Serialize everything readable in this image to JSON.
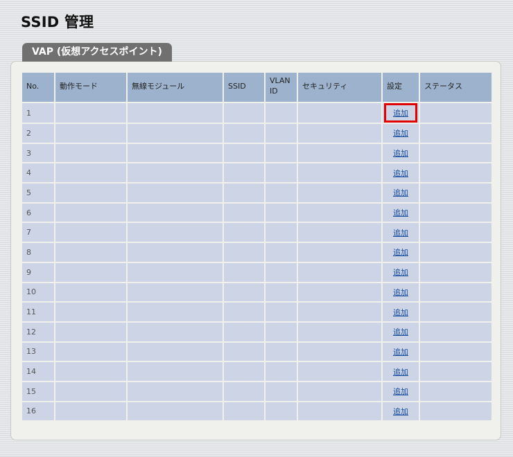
{
  "page": {
    "title": "SSID 管理"
  },
  "tab": {
    "label": "VAP (仮想アクセスポイント)"
  },
  "table": {
    "headers": {
      "no": "No.",
      "mode": "動作モード",
      "module": "無線モジュール",
      "ssid": "SSID",
      "vlan_line1": "VLAN",
      "vlan_line2": "ID",
      "security": "セキュリティ",
      "setting": "設定",
      "status": "ステータス"
    },
    "rows": [
      {
        "no": "1",
        "mode": "",
        "module": "",
        "ssid": "",
        "vlan": "",
        "security": "",
        "action": "追加",
        "status": "",
        "highlighted": true
      },
      {
        "no": "2",
        "mode": "",
        "module": "",
        "ssid": "",
        "vlan": "",
        "security": "",
        "action": "追加",
        "status": ""
      },
      {
        "no": "3",
        "mode": "",
        "module": "",
        "ssid": "",
        "vlan": "",
        "security": "",
        "action": "追加",
        "status": ""
      },
      {
        "no": "4",
        "mode": "",
        "module": "",
        "ssid": "",
        "vlan": "",
        "security": "",
        "action": "追加",
        "status": ""
      },
      {
        "no": "5",
        "mode": "",
        "module": "",
        "ssid": "",
        "vlan": "",
        "security": "",
        "action": "追加",
        "status": ""
      },
      {
        "no": "6",
        "mode": "",
        "module": "",
        "ssid": "",
        "vlan": "",
        "security": "",
        "action": "追加",
        "status": ""
      },
      {
        "no": "7",
        "mode": "",
        "module": "",
        "ssid": "",
        "vlan": "",
        "security": "",
        "action": "追加",
        "status": ""
      },
      {
        "no": "8",
        "mode": "",
        "module": "",
        "ssid": "",
        "vlan": "",
        "security": "",
        "action": "追加",
        "status": ""
      },
      {
        "no": "9",
        "mode": "",
        "module": "",
        "ssid": "",
        "vlan": "",
        "security": "",
        "action": "追加",
        "status": ""
      },
      {
        "no": "10",
        "mode": "",
        "module": "",
        "ssid": "",
        "vlan": "",
        "security": "",
        "action": "追加",
        "status": ""
      },
      {
        "no": "11",
        "mode": "",
        "module": "",
        "ssid": "",
        "vlan": "",
        "security": "",
        "action": "追加",
        "status": ""
      },
      {
        "no": "12",
        "mode": "",
        "module": "",
        "ssid": "",
        "vlan": "",
        "security": "",
        "action": "追加",
        "status": ""
      },
      {
        "no": "13",
        "mode": "",
        "module": "",
        "ssid": "",
        "vlan": "",
        "security": "",
        "action": "追加",
        "status": ""
      },
      {
        "no": "14",
        "mode": "",
        "module": "",
        "ssid": "",
        "vlan": "",
        "security": "",
        "action": "追加",
        "status": ""
      },
      {
        "no": "15",
        "mode": "",
        "module": "",
        "ssid": "",
        "vlan": "",
        "security": "",
        "action": "追加",
        "status": ""
      },
      {
        "no": "16",
        "mode": "",
        "module": "",
        "ssid": "",
        "vlan": "",
        "security": "",
        "action": "追加",
        "status": ""
      }
    ]
  },
  "colors": {
    "header_bg": "#9db3cd",
    "row_bg": "#ccd4e6",
    "tab_bg": "#707070",
    "link": "#1a4fa0",
    "highlight": "#e00000"
  }
}
